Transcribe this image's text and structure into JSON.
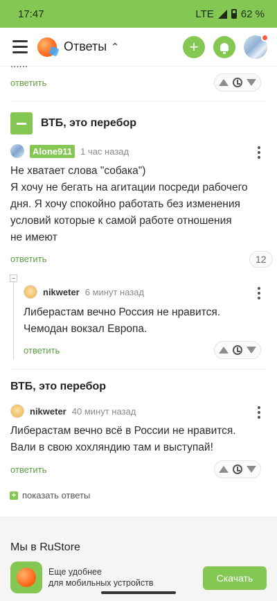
{
  "status_bar": {
    "time": "17:47",
    "network": "LTE",
    "battery": "62 %"
  },
  "header": {
    "title": "Ответы",
    "chevron": "^"
  },
  "prev_reply_link": "ответить",
  "question1": {
    "title": "ВТБ, это перебор",
    "author": "Alone911",
    "time_ago": "1 час назад",
    "lines": [
      "Не хватает слова \"собака\")",
      "Я хочу не бегать на агитации посреди рабочего",
      "дня. Я хочу спокойно работать без изменения",
      "условий которые к самой работе отношения",
      "не имеют"
    ],
    "reply_link": "ответить",
    "answers_count": "12"
  },
  "comment1": {
    "author": "nikweter",
    "time_ago": "6 минут назад",
    "lines": [
      "Либерастам вечно Россия не нравится.",
      "Чемодан вокзал Европа."
    ],
    "reply_link": "ответить"
  },
  "question2": {
    "title": "ВТБ, это перебор",
    "author": "nikweter",
    "time_ago": "40 минут назад",
    "lines": [
      "Либерастам вечно всё в России не нравится.",
      "Вали в свою хохляндию там и выступай!"
    ],
    "reply_link": "ответить",
    "show_answers": "показать ответы"
  },
  "footer": {
    "rustore_title": "Мы в RuStore",
    "rustore_text_lines": [
      "Еще удобнее",
      "для мобильных устройств"
    ],
    "download_label": "Скачать"
  },
  "colors": {
    "accent": "#84c853",
    "link": "#5d9f3e"
  },
  "icons": [
    "menu-icon",
    "app-logo-icon",
    "plus-icon",
    "bell-icon",
    "arrow-up-icon",
    "clock-icon",
    "arrow-down-icon",
    "more-vert-icon",
    "minus-icon"
  ]
}
